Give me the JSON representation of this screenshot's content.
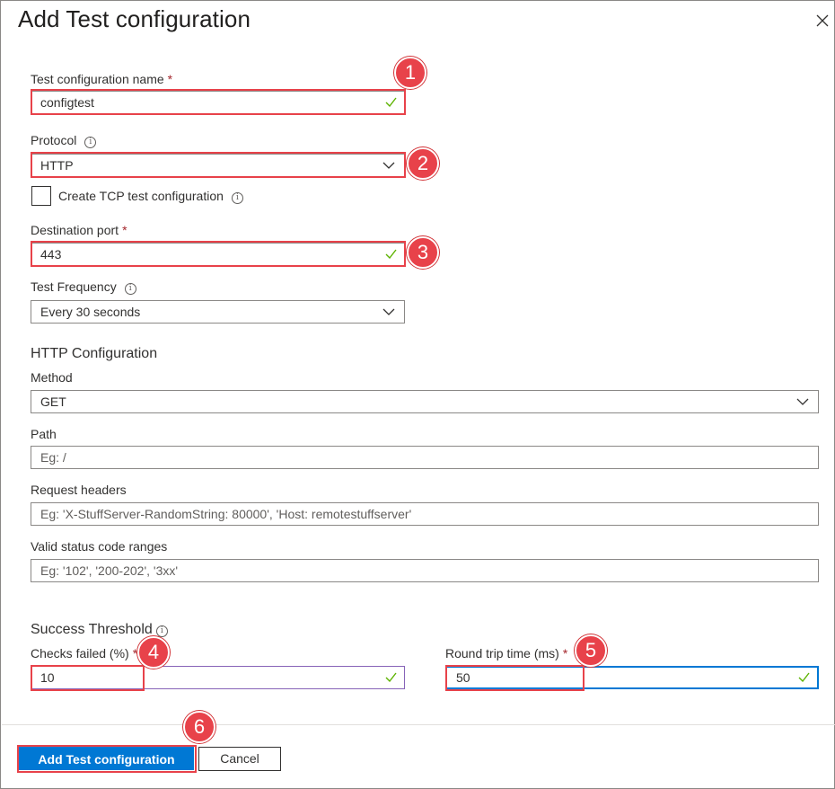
{
  "panel": {
    "title": "Add Test configuration"
  },
  "form": {
    "name_label": "Test configuration name",
    "required_mark": "*",
    "name_value": "configtest",
    "protocol_label": "Protocol",
    "protocol_value": "HTTP",
    "tcp_checkbox_label": "Create TCP test configuration",
    "port_label": "Destination port",
    "port_value": "443",
    "frequency_label": "Test Frequency",
    "frequency_value": "Every 30 seconds"
  },
  "http_config": {
    "heading": "HTTP Configuration",
    "method_label": "Method",
    "method_value": "GET",
    "path_label": "Path",
    "path_placeholder": "Eg: /",
    "headers_label": "Request headers",
    "headers_placeholder": "Eg: 'X-StuffServer-RandomString: 80000', 'Host: remotestuffserver'",
    "status_label": "Valid status code ranges",
    "status_placeholder": "Eg: '102', '200-202', '3xx'"
  },
  "success_threshold": {
    "heading": "Success Threshold",
    "checks_failed_label": "Checks failed (%)",
    "checks_failed_value": "10",
    "round_trip_label": "Round trip time (ms)",
    "round_trip_value": "50"
  },
  "footer": {
    "add_button": "Add Test configuration",
    "cancel_button": "Cancel"
  },
  "callouts": [
    "1",
    "2",
    "3",
    "4",
    "5",
    "6"
  ],
  "colors": {
    "accent": "#0078d4",
    "callout": "#e8424a",
    "valid_check": "#5db300",
    "purple_border": "#8764b8"
  },
  "icons": {
    "close": "close-icon",
    "info": "info-icon",
    "chevron": "chevron-down-icon",
    "valid": "checkmark-icon"
  }
}
